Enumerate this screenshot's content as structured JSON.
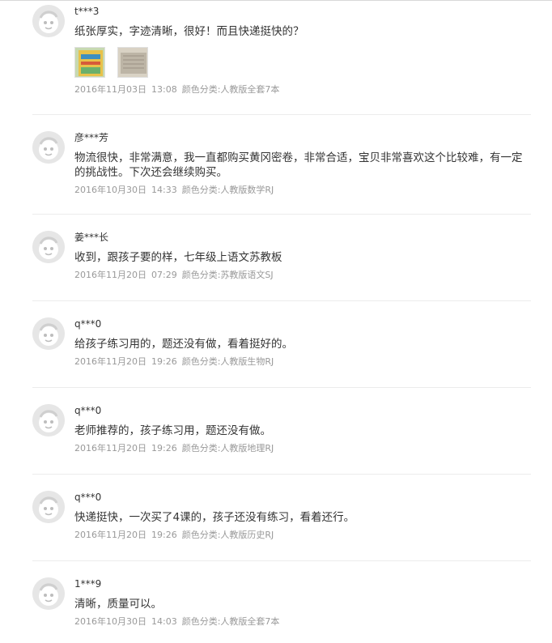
{
  "reviews": [
    {
      "user": "t***3",
      "content": "纸张厚实，字迹清晰，很好！而且快递挺快的？",
      "date": "2016年11月03日",
      "time": "13:08",
      "variant": "颜色分类:人教版全套7本",
      "photos": [
        "thumb-book-cover",
        "thumb-paper-stack"
      ]
    },
    {
      "user": "彦***芳",
      "content": "物流很快，非常满意，我一直都购买黄冈密卷，非常合适，宝贝非常喜欢这个比较难，有一定的挑战性。下次还会继续购买。",
      "date": "2016年10月30日",
      "time": "14:33",
      "variant": "颜色分类:人教版数学RJ"
    },
    {
      "user": "姜***长",
      "content": "收到，跟孩子要的样，七年级上语文苏教板",
      "date": "2016年11月20日",
      "time": "07:29",
      "variant": "颜色分类:苏教版语文SJ"
    },
    {
      "user": "q***0",
      "content": "给孩子练习用的，题还没有做，看着挺好的。",
      "date": "2016年11月20日",
      "time": "19:26",
      "variant": "颜色分类:人教版生物RJ"
    },
    {
      "user": "q***0",
      "content": "老师推荐的，孩子练习用，题还没有做。",
      "date": "2016年11月20日",
      "time": "19:26",
      "variant": "颜色分类:人教版地理RJ"
    },
    {
      "user": "q***0",
      "content": "快递挺快，一次买了4课的，孩子还没有练习，看着还行。",
      "date": "2016年11月20日",
      "time": "19:26",
      "variant": "颜色分类:人教版历史RJ"
    },
    {
      "user": "1***9",
      "content": "清晰，质量可以。",
      "date": "2016年10月30日",
      "time": "14:03",
      "variant": "颜色分类:人教版全套7本"
    }
  ],
  "icons": {
    "avatar": "default-avatar-icon"
  },
  "colors": {
    "text": "#333333",
    "meta": "#999999",
    "separator": "#ececec",
    "avatar_bg": "#e9e9e9"
  }
}
